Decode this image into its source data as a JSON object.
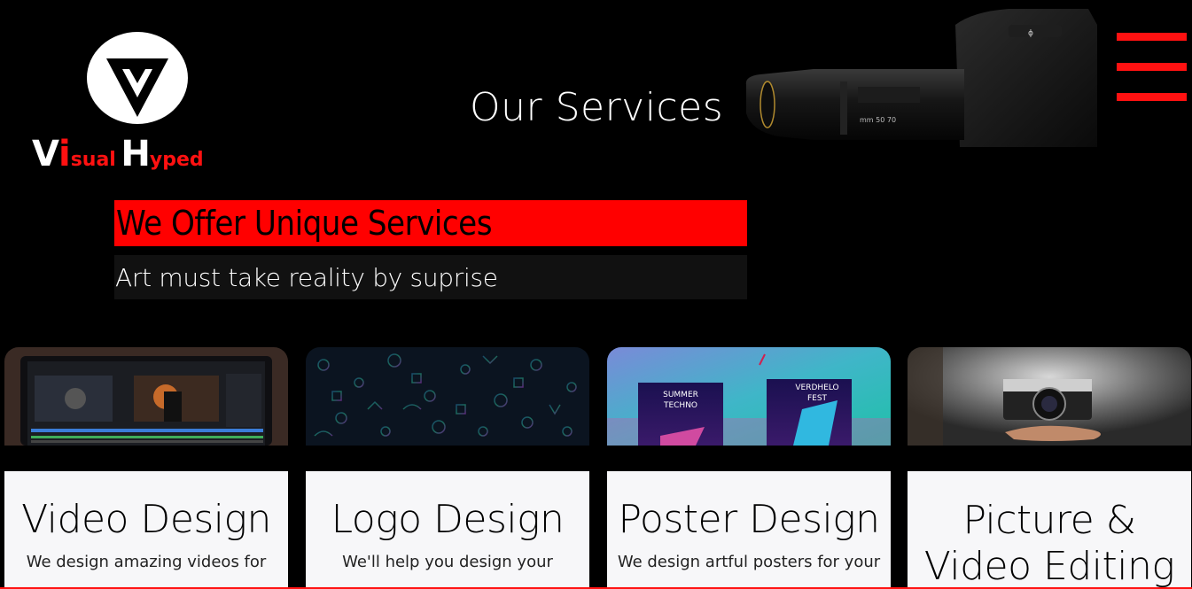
{
  "brand": {
    "word1_first": "V",
    "word1_i": "i",
    "word1_rest": "sual",
    "word2_first": "H",
    "word2_rest": "yped",
    "accent_color": "#ff1111"
  },
  "header": {
    "title": "Our Services",
    "menu_icon": "hamburger-menu-icon"
  },
  "banner": {
    "headline": "We Offer Unique Services",
    "tagline": "Art must take reality by suprise"
  },
  "services": [
    {
      "title": "Video Design",
      "description": "We design amazing videos for",
      "image": "video-editing-screen"
    },
    {
      "title": "Logo Design",
      "description": "We'll help you design your",
      "image": "doodle-pattern"
    },
    {
      "title": "Poster Design",
      "description": "We design artful posters for your",
      "image": "poster-mockups"
    },
    {
      "title_line1": "Picture &",
      "title_line2": "Video Editing",
      "image": "hand-holding-camera"
    }
  ],
  "poster_texts": {
    "left": "SUMMER\nTECHNO",
    "right": "VERDHELO\nFEST"
  }
}
